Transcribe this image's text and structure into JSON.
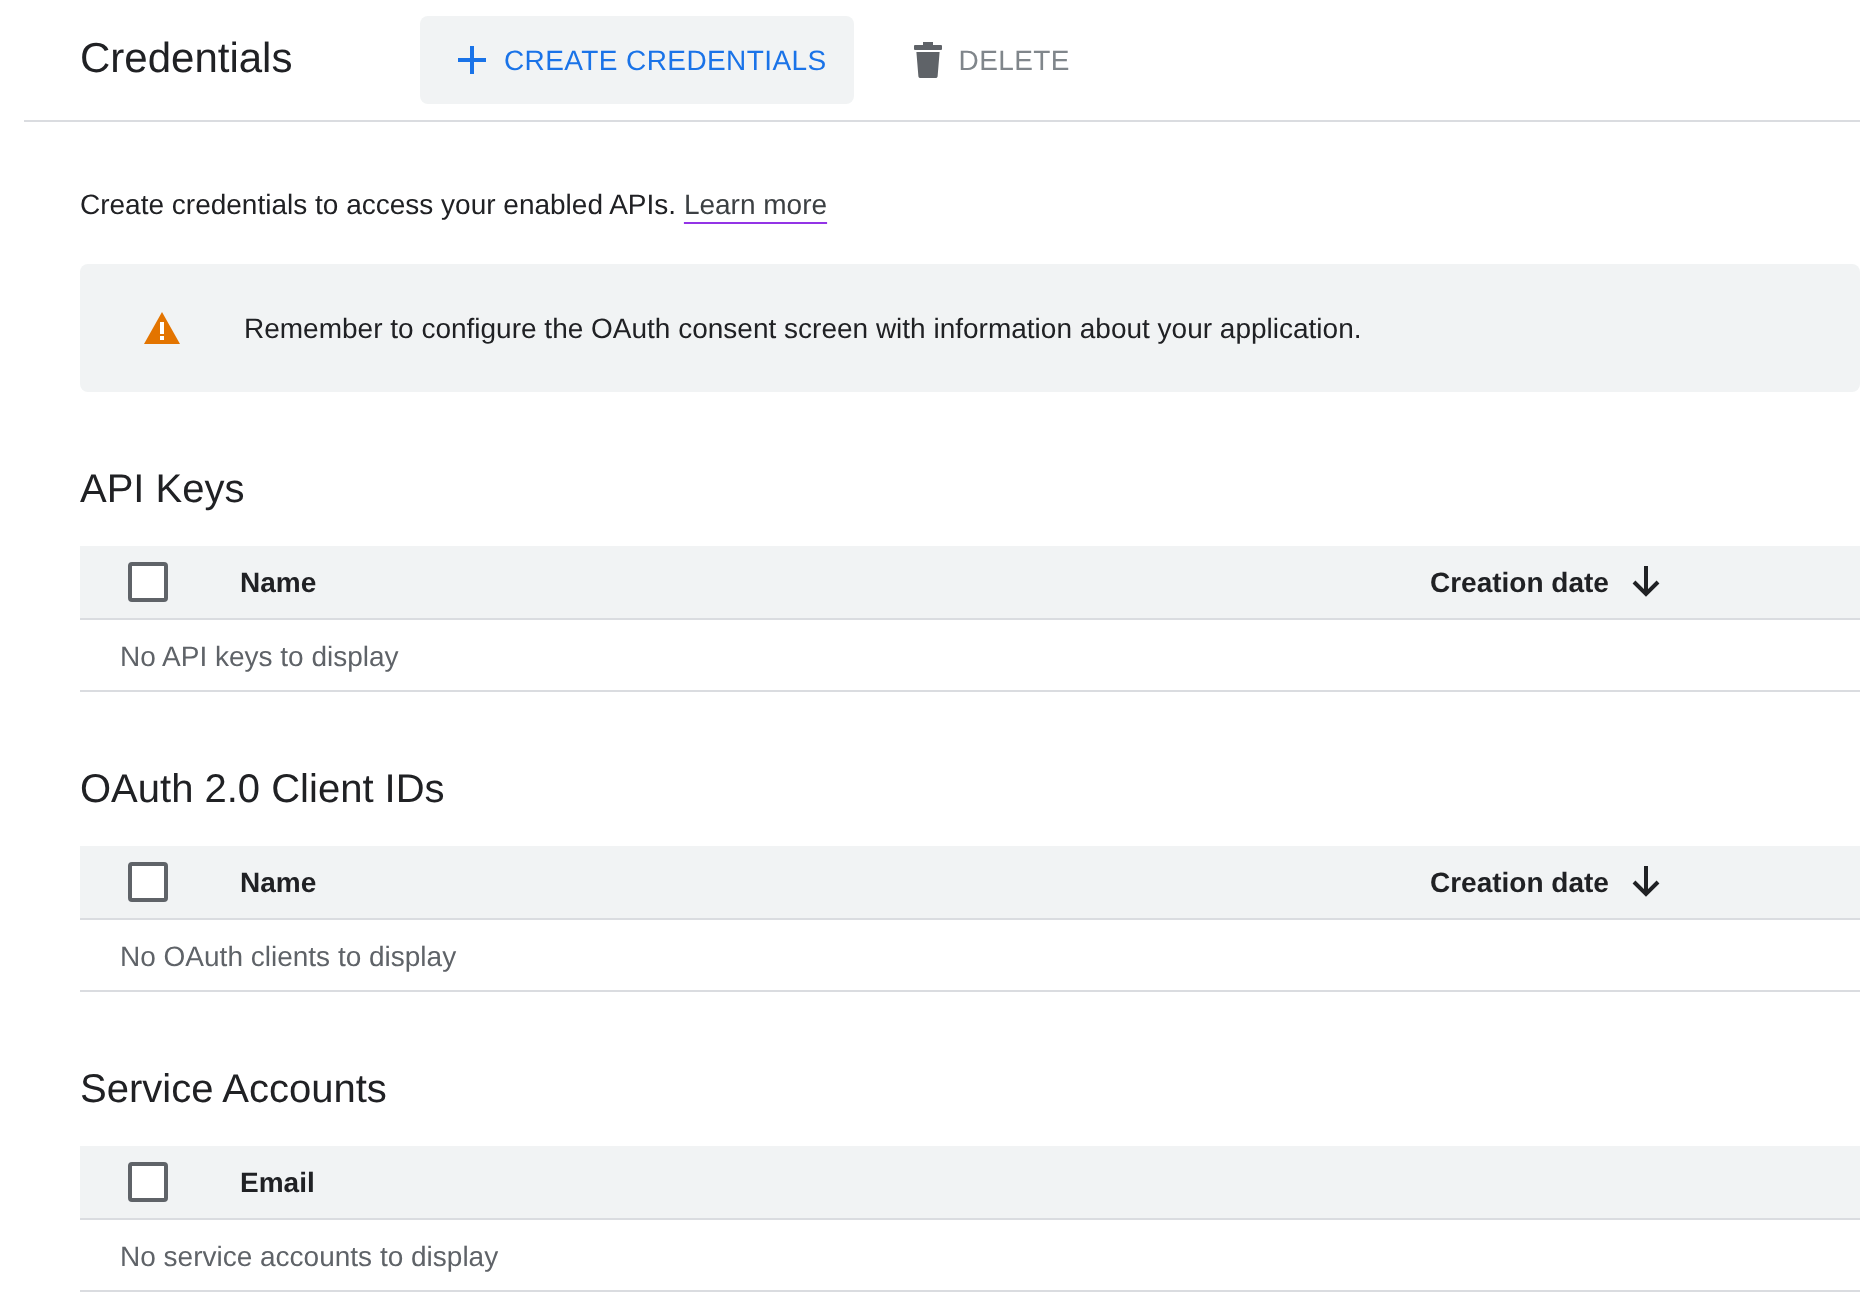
{
  "header": {
    "title": "Credentials",
    "actions": [
      {
        "kind": "create",
        "label": "CREATE CREDENTIALS",
        "disabled": false
      },
      {
        "kind": "delete",
        "label": "DELETE",
        "disabled": true
      }
    ]
  },
  "intro": {
    "text": "Create credentials to access your enabled APIs.",
    "link": "Learn more"
  },
  "alert": {
    "kind": "warning",
    "text": "Remember to configure the OAuth consent screen with information about your application."
  },
  "sections": [
    {
      "title": "API Keys",
      "select_all": {
        "checked": false
      },
      "columns": [
        {
          "label": "Name",
          "sorted": false
        },
        {
          "label": "Creation date",
          "sorted": true
        }
      ],
      "empty_text": "No API keys to display"
    },
    {
      "title": "OAuth 2.0 Client IDs",
      "select_all": {
        "checked": false
      },
      "columns": [
        {
          "label": "Name",
          "sorted": false
        },
        {
          "label": "Creation date",
          "sorted": true
        }
      ],
      "empty_text": "No OAuth clients to display"
    },
    {
      "title": "Service Accounts",
      "select_all": {
        "checked": false
      },
      "columns": [
        {
          "label": "Email",
          "sorted": false
        }
      ],
      "empty_text": "No service accounts to display"
    }
  ]
}
